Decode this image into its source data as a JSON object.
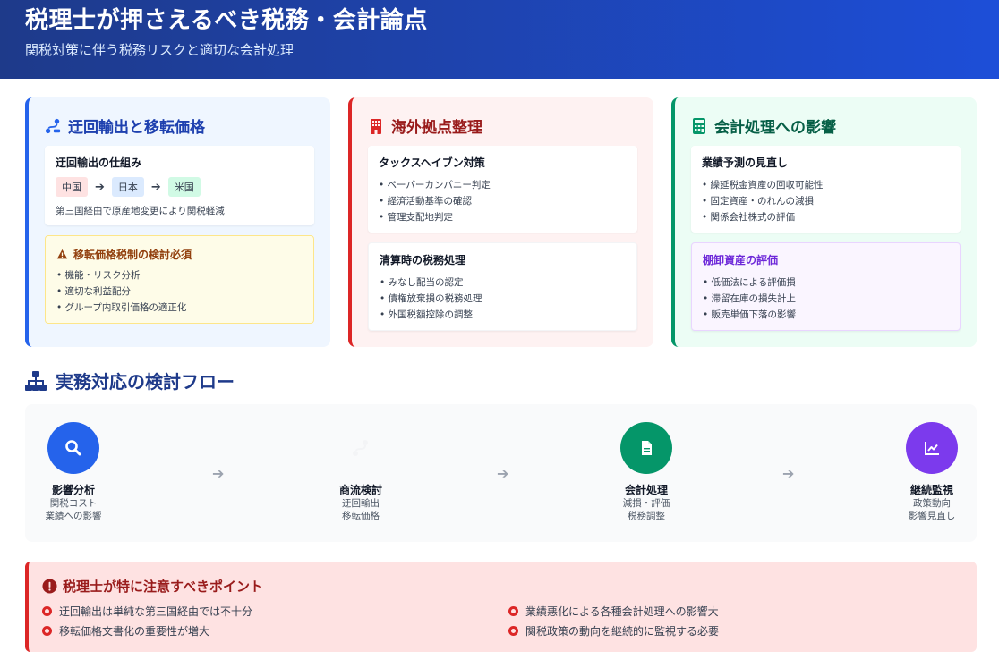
{
  "header": {
    "title": "税理士が押さえるべき税務・会計論点",
    "subtitle": "関税対策に伴う税務リスクと適切な会計処理"
  },
  "cards": {
    "transfer": {
      "title": "迂回輸出と移転価格",
      "icon": "route-icon",
      "mechanism": {
        "title": "迂回輸出の仕組み",
        "route": [
          "中国",
          "日本",
          "米国"
        ],
        "note": "第三国経由で原産地変更により関税軽減"
      },
      "warning": {
        "title": "移転価格税制の検討必須",
        "items": [
          "機能・リスク分析",
          "適切な利益配分",
          "グループ内取引価格の適正化"
        ]
      }
    },
    "overseas": {
      "title": "海外拠点整理",
      "icon": "building-icon",
      "haven": {
        "title": "タックスヘイブン対策",
        "items": [
          "ペーパーカンパニー判定",
          "経済活動基準の確認",
          "管理支配地判定"
        ]
      },
      "liquidation": {
        "title": "清算時の税務処理",
        "items": [
          "みなし配当の認定",
          "債権放棄損の税務処理",
          "外国税額控除の調整"
        ]
      }
    },
    "accounting": {
      "title": "会計処理への影響",
      "icon": "calculator-icon",
      "forecast": {
        "title": "業績予測の見直し",
        "items": [
          "繰延税金資産の回収可能性",
          "固定資産・のれんの減損",
          "関係会社株式の評価"
        ]
      },
      "inventory": {
        "title": "棚卸資産の評価",
        "items": [
          "低価法による評価損",
          "滞留在庫の損失計上",
          "販売単価下落の影響"
        ]
      }
    }
  },
  "flow": {
    "title": "実務対応の検討フロー",
    "steps": [
      {
        "name": "影響分析",
        "desc1": "関税コスト",
        "desc2": "業績への影響",
        "color": "#2563eb",
        "icon": "search-icon"
      },
      {
        "name": "商流検討",
        "desc1": "迂回輸出",
        "desc2": "移転価格",
        "color": "#f9fafb",
        "icon": "route-icon"
      },
      {
        "name": "会計処理",
        "desc1": "減損・評価",
        "desc2": "税務調整",
        "color": "#059669",
        "icon": "document-icon"
      },
      {
        "name": "継続監視",
        "desc1": "政策動向",
        "desc2": "影響見直し",
        "color": "#7c3aed",
        "icon": "chart-line-icon"
      }
    ],
    "arrow": "➔"
  },
  "alert": {
    "title": "税理士が特に注意すべきポイント",
    "items": [
      "迂回輸出は単純な第三国経由では不十分",
      "業績悪化による各種会計処理への影響大",
      "移転価格文書化の重要性が増大",
      "関税政策の動向を継続的に監視する必要"
    ]
  }
}
